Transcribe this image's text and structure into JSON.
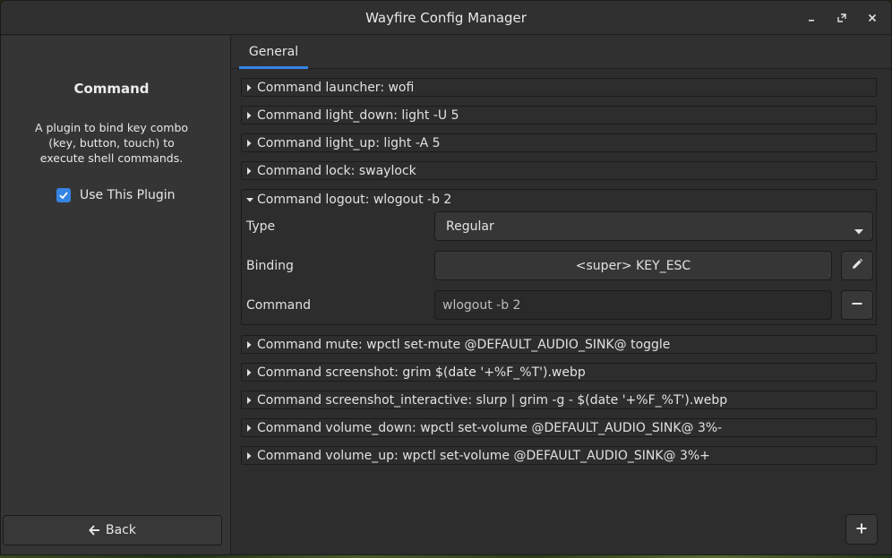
{
  "window": {
    "title": "Wayfire Config Manager",
    "controls": {
      "minimize": "minimize-icon",
      "maximize": "maximize-icon",
      "close": "close-icon"
    }
  },
  "sidebar": {
    "plugin_name": "Command",
    "description": "A plugin to bind key combo (key, button, touch) to execute shell commands.",
    "use_plugin_label": "Use This Plugin",
    "use_plugin_checked": true,
    "back_label": "Back"
  },
  "tabs": [
    {
      "label": "General",
      "active": true
    }
  ],
  "commands_before": [
    {
      "label": "Command launcher: wofi"
    },
    {
      "label": "Command light_down: light -U 5"
    },
    {
      "label": "Command light_up: light -A 5"
    },
    {
      "label": "Command lock: swaylock"
    }
  ],
  "expanded": {
    "label": "Command logout: wlogout -b 2",
    "type_label": "Type",
    "type_value": "Regular",
    "binding_label": "Binding",
    "binding_value": "<super> KEY_ESC",
    "command_label": "Command",
    "command_value": "wlogout -b 2"
  },
  "commands_after": [
    {
      "label": "Command mute: wpctl set-mute @DEFAULT_AUDIO_SINK@ toggle"
    },
    {
      "label": "Command screenshot: grim $(date '+%F_%T').webp"
    },
    {
      "label": "Command screenshot_interactive: slurp | grim -g - $(date '+%F_%T').webp"
    },
    {
      "label": "Command volume_down: wpctl set-volume @DEFAULT_AUDIO_SINK@ 3%-"
    },
    {
      "label": "Command volume_up: wpctl set-volume @DEFAULT_AUDIO_SINK@ 3%+"
    }
  ],
  "colors": {
    "accent": "#3584e4",
    "window_bg": "#2d2d2d",
    "sidebar_bg": "#353535"
  }
}
